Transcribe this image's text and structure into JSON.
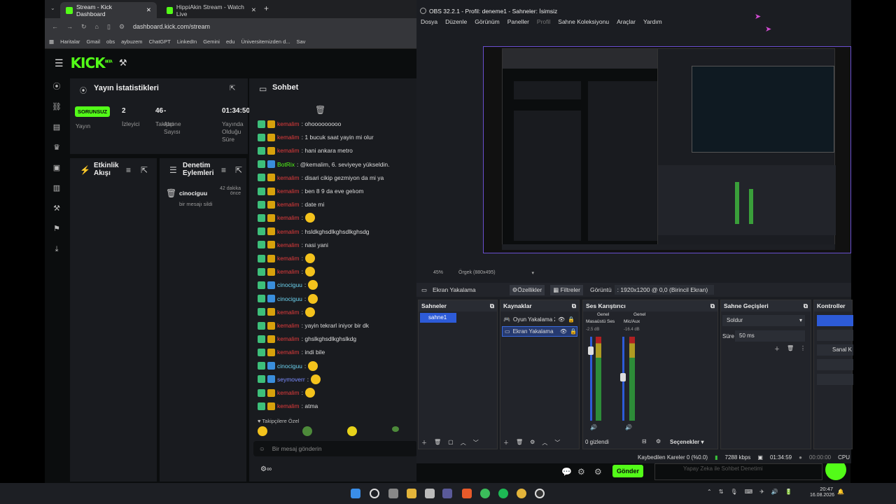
{
  "browser": {
    "tabs": [
      {
        "label": "Stream - Kick Dashboard"
      },
      {
        "label": "HippiAkin Stream - Watch Live"
      }
    ],
    "new_tab": "+",
    "url": "dashboard.kick.com/stream",
    "bookmarks": [
      "Haritalar",
      "Gmail",
      "obs",
      "aybuzem",
      "ChatGPT",
      "LinkedIn",
      "Gemini",
      "edu",
      "Üniversitemizden d...",
      "Sav"
    ]
  },
  "kick": {
    "logo": "KICK",
    "logo_sup": "BETA",
    "stats_title": "Yayın İstatistikleri",
    "status_badge": "SORUNSUZ",
    "stats": [
      {
        "value": "",
        "label": "Yayın"
      },
      {
        "value": "2",
        "label": "İzleyici"
      },
      {
        "value": "46",
        "label": "Takipçi"
      },
      {
        "value": "-",
        "label": "Abone Sayısı"
      },
      {
        "value": "01:34:50",
        "label": "Yayında Olduğu Süre"
      }
    ],
    "activity_title": "Etkinlik Akışı",
    "moderation_title": "Denetim Eylemleri",
    "mod_action": {
      "user": "cinociguu",
      "text": "bir mesajı sildi",
      "time": "42 dakika önce"
    },
    "chat_title": "Sohbet",
    "chat": [
      {
        "user": "kemalim",
        "text": ": ohooooooooo",
        "color": "red"
      },
      {
        "user": "kemalim",
        "text": ": 1 bucuk saat yayin mi olur",
        "color": "red"
      },
      {
        "user": "kemalim",
        "text": ": hani ankara metro",
        "color": "red"
      },
      {
        "user": "BotRix",
        "text": ": @kemalim, 6. seviyeye yükseldin.",
        "color": "green"
      },
      {
        "user": "kemalim",
        "text": ": disari cikip gezmiyon da mi ya",
        "color": "red"
      },
      {
        "user": "kemalim",
        "text": ": ben 8 9 da eve gelıom",
        "color": "red"
      },
      {
        "user": "kemalim",
        "text": ": date mi",
        "color": "red"
      },
      {
        "user": "kemalim",
        "text": ":",
        "color": "red"
      },
      {
        "user": "kemalim",
        "text": ": hsldkghsdlkghsdlkghsdg",
        "color": "red"
      },
      {
        "user": "kemalim",
        "text": ": nasi yani",
        "color": "red"
      },
      {
        "user": "kemalim",
        "text": ":",
        "color": "red"
      },
      {
        "user": "kemalim",
        "text": ":",
        "color": "red"
      },
      {
        "user": "cinociguu",
        "text": ":",
        "color": "cyan"
      },
      {
        "user": "cinociguu",
        "text": ":",
        "color": "cyan"
      },
      {
        "user": "kemalim",
        "text": ":",
        "color": "red"
      },
      {
        "user": "kemalim",
        "text": ": yayin tekrarl iniyor bir dk",
        "color": "red"
      },
      {
        "user": "kemalim",
        "text": ": ghslkghsdlkghslkdg",
        "color": "red"
      },
      {
        "user": "kemalim",
        "text": ": indi bile",
        "color": "red"
      },
      {
        "user": "cinociguu",
        "text": ":",
        "color": "cyan"
      },
      {
        "user": "seymoverr",
        "text": ":",
        "color": "blue"
      },
      {
        "user": "kemalim",
        "text": ":",
        "color": "red"
      },
      {
        "user": "kemalim",
        "text": ": atma",
        "color": "red"
      }
    ],
    "followers_only": "Takipçilere Özel",
    "chat_placeholder": "Bir mesaj gönderin",
    "send_label": "Gönder"
  },
  "obs": {
    "title": "OBS 32.2.1 - Profil: deneme1 - Sahneler: İsimsiz",
    "menu": [
      "Dosya",
      "Düzenle",
      "Görünüm",
      "Paneller",
      "Profil",
      "Sahne Koleksiyonu",
      "Araçlar",
      "Yardım"
    ],
    "zoom": "45%",
    "canvas": "Örgek (880x495)",
    "source_selected": "Ekran Yakalama",
    "props_label": "Özellikler",
    "filters_label": "Filtreler",
    "display_label": "Görüntü",
    "display_value": ": 1920x1200 @ 0,0 (Birincil Ekran)",
    "scenes_title": "Sahneler",
    "scene": "sahne1",
    "sources_title": "Kaynaklar",
    "sources": [
      "Oyun Yakalama 2",
      "Ekran Yakalama"
    ],
    "mixer_title": "Ses Karıştırıcı",
    "mixer_channels": [
      {
        "label": "Genel",
        "name": "Masaüstü Ses",
        "db": "-2.5 dB"
      },
      {
        "label": "Genel",
        "name": "Mic/Aux",
        "db": "-16.4 dB"
      }
    ],
    "hidden_count": "0 gizlendi",
    "options_label": "Seçenekler",
    "transitions_title": "Sahne Geçişleri",
    "transition": "Soldur",
    "duration_label": "Süre",
    "duration_value": "50 ms",
    "controls_title": "Kontroller",
    "controls_partial": "Sanal K",
    "status": {
      "dropped": "Kaybedilen Kareler 0 (%0.0)",
      "kbps": "7288 kbps",
      "live_time": "01:34:59",
      "rec_time": "00:00:00",
      "cpu": "CPU"
    },
    "ai_hint": "Yapay Zeka ile Sohbet Denetimi"
  },
  "taskbar": {
    "time": "20:47",
    "date": "16.08.2026"
  }
}
